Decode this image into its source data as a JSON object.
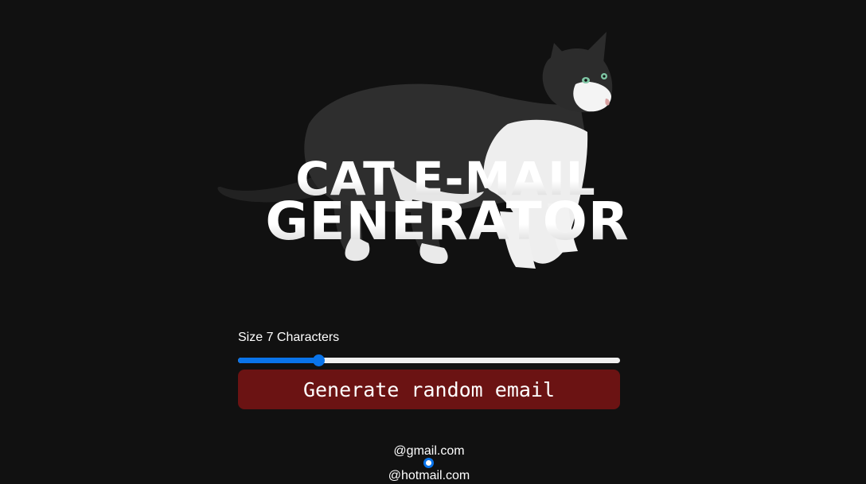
{
  "hero": {
    "title_line1": "CAT E-MAIL",
    "title_line2": "GENERATOR",
    "image": "cat-photo"
  },
  "size_control": {
    "label": "Size 7 Characters",
    "value": 7,
    "fill_fraction": 0.21
  },
  "generate_button": {
    "label": "Generate random email"
  },
  "domains": {
    "options": [
      {
        "label": "@gmail.com",
        "selected": true
      },
      {
        "label": "@hotmail.com",
        "selected": false
      }
    ]
  },
  "colors": {
    "background": "#111111",
    "accent": "#0a74ea",
    "button": "#6b1313",
    "text": "#ffffff"
  }
}
